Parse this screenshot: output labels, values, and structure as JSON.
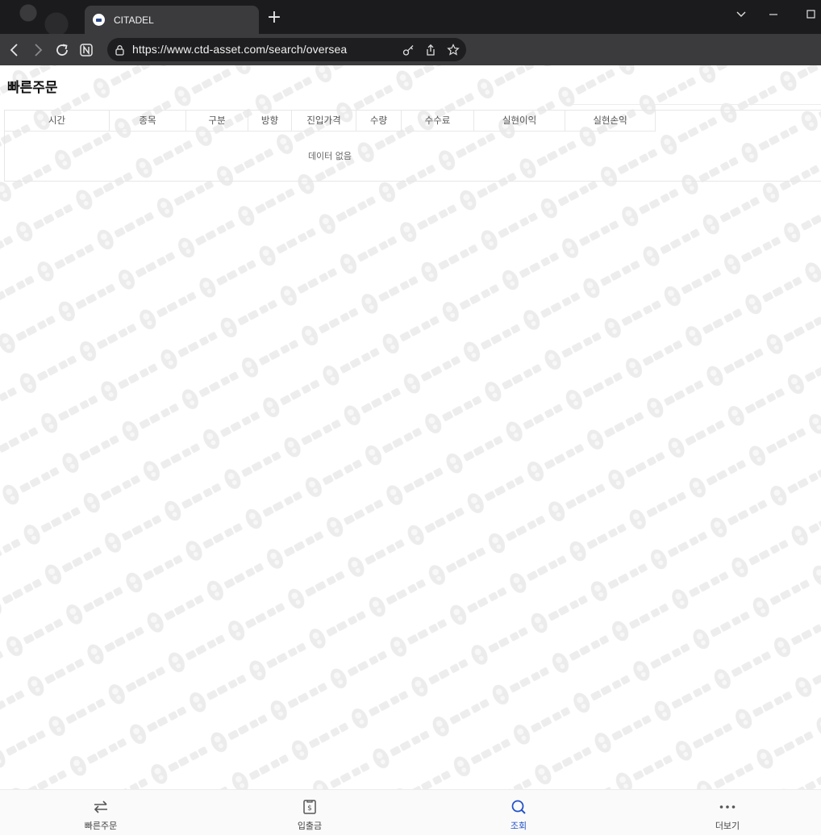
{
  "browser": {
    "tab_title": "CITADEL",
    "url": "https://www.ctd-asset.com/search/oversea"
  },
  "page": {
    "title": "빠른주문",
    "watermark_text": "담덕 법률사무소"
  },
  "table": {
    "columns": [
      "시간",
      "종목",
      "구분",
      "방향",
      "진입가격",
      "수량",
      "수수료",
      "실현이익",
      "실현손익"
    ],
    "rows": [],
    "empty_text": "데이터 없음"
  },
  "bottom_nav": {
    "items": [
      {
        "label": "빠른주문",
        "icon": "swap-arrows-icon",
        "active": false
      },
      {
        "label": "입출금",
        "icon": "deposit-document-icon",
        "active": false
      },
      {
        "label": "조회",
        "icon": "search-icon",
        "active": true
      },
      {
        "label": "더보기",
        "icon": "more-dots-icon",
        "active": false
      }
    ],
    "active_color": "#2251c8"
  }
}
